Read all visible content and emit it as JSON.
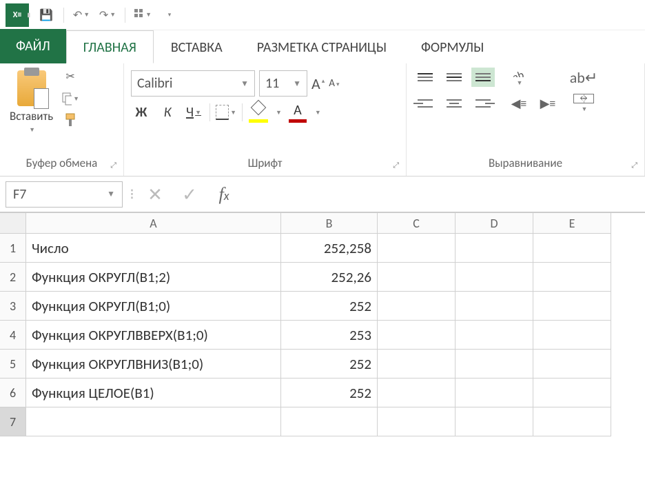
{
  "qat": {
    "save": "💾",
    "undo": "↶",
    "redo": "↷",
    "touch": "☰"
  },
  "tabs": {
    "file": "ФАЙЛ",
    "home": "ГЛАВНАЯ",
    "insert": "ВСТАВКА",
    "layout": "РАЗМЕТКА СТРАНИЦЫ",
    "formulas": "ФОРМУЛЫ"
  },
  "ribbon": {
    "clipboard": {
      "paste": "Вставить",
      "label": "Буфер обмена"
    },
    "font": {
      "name": "Calibri",
      "size": "11",
      "bold": "Ж",
      "italic": "К",
      "underline": "Ч",
      "label": "Шрифт"
    },
    "align": {
      "label": "Выравнивание"
    }
  },
  "namebox": "F7",
  "formula": "",
  "columns": [
    "A",
    "B",
    "C",
    "D",
    "E"
  ],
  "rows": [
    {
      "n": "1",
      "A": "Число",
      "B": "252,258"
    },
    {
      "n": "2",
      "A": "Функция ОКРУГЛ(B1;2)",
      "B": "252,26"
    },
    {
      "n": "3",
      "A": "Функция ОКРУГЛ(B1;0)",
      "B": "252"
    },
    {
      "n": "4",
      "A": "Функция ОКРУГЛВВЕРХ(B1;0)",
      "B": "253"
    },
    {
      "n": "5",
      "A": "Функция ОКРУГЛВНИЗ(B1;0)",
      "B": "252"
    },
    {
      "n": "6",
      "A": "Функция ЦЕЛОЕ(B1)",
      "B": "252"
    },
    {
      "n": "7",
      "A": "",
      "B": ""
    }
  ],
  "selected_row": "7"
}
